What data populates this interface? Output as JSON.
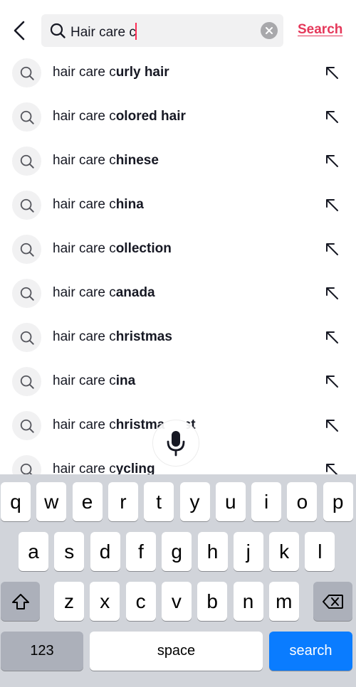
{
  "header": {
    "back_icon": "chevron-left-icon",
    "search_icon": "search-icon",
    "query": "Hair care c",
    "clear_icon": "clear-x-icon",
    "search_label": "Search",
    "accent_color": "#e5385a"
  },
  "suggestions": [
    {
      "prefix": "hair care c",
      "rest": "urly hair"
    },
    {
      "prefix": "hair care c",
      "rest": "olored hair"
    },
    {
      "prefix": "hair care c",
      "rest": "hinese"
    },
    {
      "prefix": "hair care c",
      "rest": "hina"
    },
    {
      "prefix": "hair care c",
      "rest": "ollection"
    },
    {
      "prefix": "hair care c",
      "rest": "anada"
    },
    {
      "prefix": "hair care c",
      "rest": "hristmas"
    },
    {
      "prefix": "hair care c",
      "rest": "ina"
    },
    {
      "prefix": "hair care c",
      "rest": "hristmas list"
    },
    {
      "prefix": "hair care c",
      "rest": "ycling"
    }
  ],
  "mic": {
    "icon": "microphone-icon"
  },
  "keyboard": {
    "row1": [
      "q",
      "w",
      "e",
      "r",
      "t",
      "y",
      "u",
      "i",
      "o",
      "p"
    ],
    "row2": [
      "a",
      "s",
      "d",
      "f",
      "g",
      "h",
      "j",
      "k",
      "l"
    ],
    "row3": [
      "z",
      "x",
      "c",
      "v",
      "b",
      "n",
      "m"
    ],
    "shift_icon": "shift-icon",
    "delete_icon": "backspace-icon",
    "numbers_label": "123",
    "space_label": "space",
    "search_label": "search",
    "search_color": "#0a7cff"
  }
}
